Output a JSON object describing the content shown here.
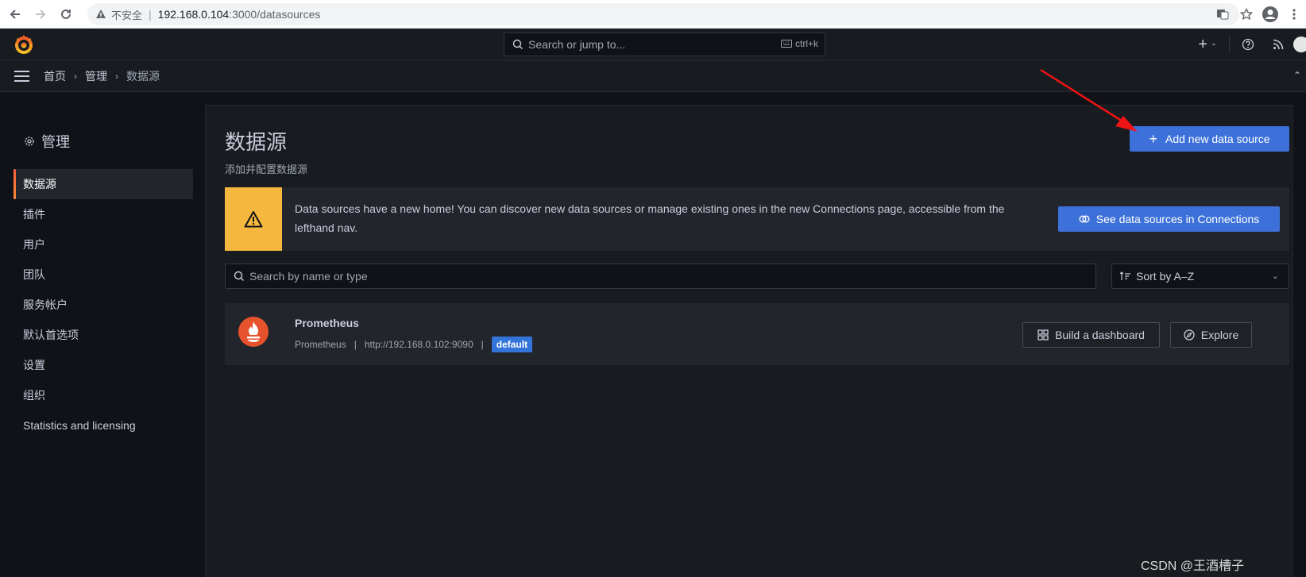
{
  "browser": {
    "insecure_label": "不安全",
    "url_host": "192.168.0.104",
    "url_path": ":3000/datasources"
  },
  "topbar": {
    "search_placeholder": "Search or jump to...",
    "search_shortcut": "ctrl+k",
    "plus_label": "+"
  },
  "breadcrumb": {
    "items": [
      "首页",
      "管理",
      "数据源"
    ]
  },
  "sidebar": {
    "title": "管理",
    "items": [
      {
        "label": "数据源",
        "active": true
      },
      {
        "label": "插件"
      },
      {
        "label": "用户"
      },
      {
        "label": "团队"
      },
      {
        "label": "服务帐户"
      },
      {
        "label": "默认首选项"
      },
      {
        "label": "设置"
      },
      {
        "label": "组织"
      },
      {
        "label": "Statistics and licensing"
      }
    ]
  },
  "main": {
    "title": "数据源",
    "subtitle": "添加并配置数据源",
    "add_button": "Add new data source",
    "alert": {
      "text": "Data sources have a new home! You can discover new data sources or manage existing ones in the new Connections page, accessible from the lefthand nav.",
      "button": "See data sources in Connections"
    },
    "search_placeholder": "Search by name or type",
    "sort_label": "Sort by A–Z",
    "datasources": [
      {
        "name": "Prometheus",
        "type": "Prometheus",
        "url": "http://192.168.0.102:9090",
        "badge": "default",
        "build_button": "Build a dashboard",
        "explore_button": "Explore"
      }
    ]
  },
  "watermark": "CSDN @王酒槽子",
  "colors": {
    "primary": "#3d71d9",
    "warning": "#f5b73d",
    "active_accent": "#f55f3e",
    "background": "#111217",
    "panel": "#181b1f"
  }
}
